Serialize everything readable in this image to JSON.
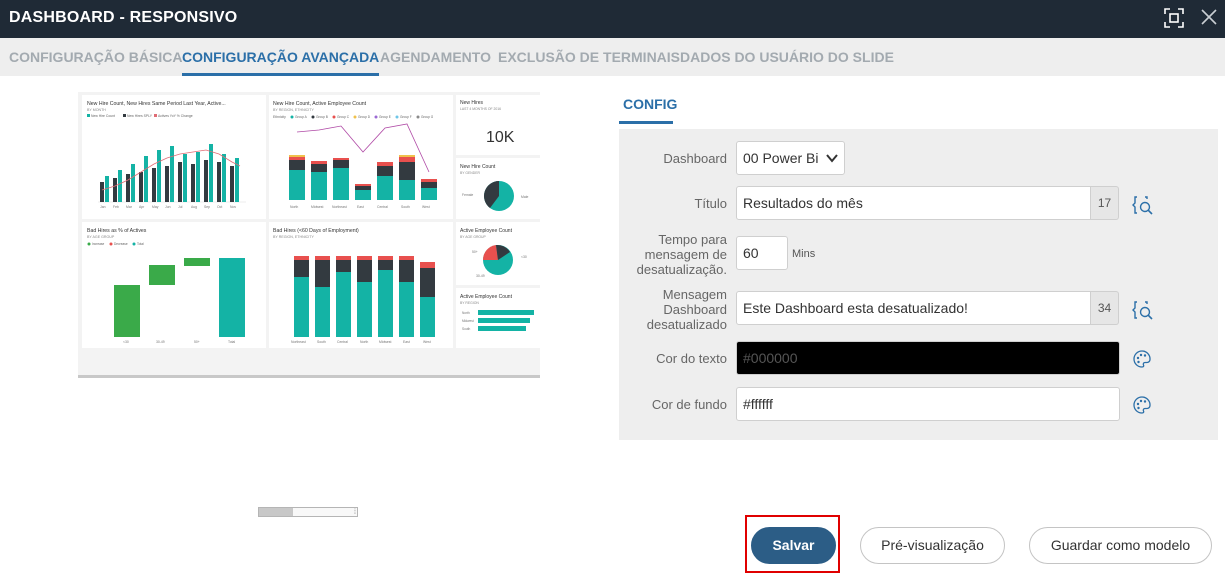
{
  "window": {
    "title": "DASHBOARD - RESPONSIVO",
    "expand_icon": "fullscreen-icon",
    "close_icon": "close-icon"
  },
  "tabs": [
    {
      "label": "CONFIGURAÇÃO BÁSICA",
      "active": false
    },
    {
      "label": "CONFIGURAÇÃO AVANÇADA",
      "active": true
    },
    {
      "label": "AGENDAMENTO",
      "active": false
    },
    {
      "label": "EXCLUSÃO DE TERMINAIS",
      "active": false
    },
    {
      "label": "DADOS DO USUÁRIO DO SLIDE",
      "active": false
    }
  ],
  "preview": {
    "tiles": {
      "hires_chart_title": "New Hire Count, New Hires Same Period Last Year, Active...",
      "hires_chart_sub": "BY MONTH",
      "hires_chart_legend": [
        "New Hire Count",
        "New Hires SPLY",
        "Actives YoY % Change"
      ],
      "months": [
        "Jan",
        "Feb",
        "Mar",
        "Apr",
        "May",
        "Jun",
        "Jul",
        "Aug",
        "Sep",
        "Oct",
        "Nov"
      ],
      "region_chart_title": "New Hire Count, Active Employee Count",
      "region_chart_sub": "BY REGION, ETHNICITY",
      "region_legend_label": "Ethnicity",
      "region_legend": [
        "Group A",
        "Group B",
        "Group C",
        "Group D",
        "Group E",
        "Group F",
        "Group G"
      ],
      "regions": [
        "North",
        "Midwest",
        "Northeast",
        "East",
        "Central",
        "South",
        "West"
      ],
      "kpi_title": "New Hires",
      "kpi_sub": "LAST 4 MONTHS OF 2016",
      "kpi_value": "10K",
      "pie1_title": "New Hire Count",
      "pie1_sub": "BY GENDER",
      "pie1_labels": [
        "Female",
        "Male"
      ],
      "bad_hires_title": "Bad Hires as % of Actives",
      "bad_hires_sub": "BY AGE GROUP",
      "bad_hires_legend": [
        "Increase",
        "Decrease",
        "Total"
      ],
      "age_groups": [
        "<30",
        "30-49",
        "50+",
        "Total"
      ],
      "bad90_title": "Bad Hires (<60 Days of Employment)",
      "bad90_sub": "BY REGION, ETHNICITY",
      "bad90_regions": [
        "Northeast",
        "South",
        "Central",
        "North",
        "Midwest",
        "East",
        "West"
      ],
      "pie2_title": "Active Employee Count",
      "pie2_sub": "BY AGE GROUP",
      "pie2_labels": [
        "50+",
        "<30",
        "30-49"
      ],
      "bars_title": "Active Employee Count",
      "bars_sub": "BY REGION",
      "bars_labels": [
        "North",
        "Midwest",
        "South"
      ]
    }
  },
  "config": {
    "section_tab": "CONFIG",
    "dashboard": {
      "label": "Dashboard",
      "value": "00 Power Bi"
    },
    "titulo": {
      "label": "Título",
      "value": "Resultados do mês",
      "count": "17"
    },
    "tempo": {
      "label": "Tempo para mensagem de desatualização.",
      "value": "60",
      "units": "Mins"
    },
    "mensagem": {
      "label": "Mensagem Dashboard desatualizado",
      "value": "Este Dashboard esta desatualizado!",
      "count": "34"
    },
    "cor_texto": {
      "label": "Cor do texto",
      "value": "#000000",
      "swatch": "#000000"
    },
    "cor_fundo": {
      "label": "Cor de fundo",
      "value": "#ffffff",
      "swatch": "#ffffff"
    }
  },
  "buttons": {
    "save": "Salvar",
    "preview": "Pré-visualização",
    "save_template": "Guardar como modelo"
  },
  "colors": {
    "header_bg": "#1f2a36",
    "accent": "#2b6fa8",
    "primary_button": "#2c5d86",
    "highlight": "#e00000",
    "teal": "#14b3a5",
    "dark": "#333a40",
    "green": "#3aaa49",
    "red": "#e8504e"
  }
}
